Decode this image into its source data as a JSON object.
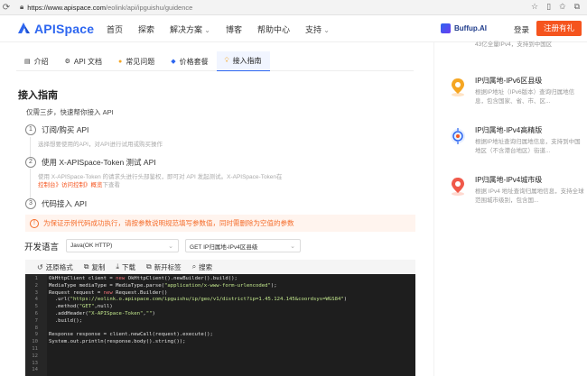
{
  "browser": {
    "url_host": "https://www.apispace.com",
    "url_path": "/eolink/api/ipguishu/guidence"
  },
  "header": {
    "logo_text": "APISpace",
    "nav": [
      {
        "label": "首页",
        "dropdown": false
      },
      {
        "label": "探索",
        "dropdown": false
      },
      {
        "label": "解决方案",
        "dropdown": true
      },
      {
        "label": "博客",
        "dropdown": false
      },
      {
        "label": "帮助中心",
        "dropdown": false
      },
      {
        "label": "支持",
        "dropdown": true
      }
    ],
    "buffup_label": "Buffup.AI",
    "login_label": "登录",
    "register_label": "注册有礼"
  },
  "tabs": [
    {
      "label": "介绍",
      "icon": "doc-icon",
      "active": false
    },
    {
      "label": "API 文档",
      "icon": "api-doc-icon",
      "active": false
    },
    {
      "label": "常见问题",
      "icon": "faq-icon",
      "active": false
    },
    {
      "label": "价格套餐",
      "icon": "diamond-icon",
      "active": false
    },
    {
      "label": "接入指南",
      "icon": "bulb-icon",
      "active": true
    }
  ],
  "guide": {
    "title": "接入指南",
    "subtitle": "仅需三步，快速帮你接入 API",
    "steps": [
      {
        "num": "1",
        "title": "订阅/购买 API",
        "desc": "选择想要使用的API，对API进行试用或购买操作"
      },
      {
        "num": "2",
        "title": "使用 X-APISpace-Token 测试 API",
        "desc_line1": "使用 X-APISpace-Token 的请求头进行头部鉴权，即可对 API 发起测试。X-APISpace-Token在",
        "desc_link": "控制台》访问控制》概览",
        "desc_suffix": "下查看"
      },
      {
        "num": "3",
        "title": "代码接入 API"
      }
    ],
    "warning": "为保证示例代码成功执行，请按参数说明规范填写参数值，同时需删除为空值的参数"
  },
  "dev": {
    "label": "开发语言",
    "language_value": "Java(OK HTTP)",
    "api_value": "GET IP归属地-IPv4区县级"
  },
  "toolbar": {
    "reset": "还原格式",
    "copy": "复制",
    "download": "下载",
    "new_tab": "新开标签",
    "search": "搜索"
  },
  "code_lines": [
    {
      "n": "1",
      "parts": [
        [
          "",
          "OkHttpClient client = "
        ],
        [
          "kw",
          "new"
        ],
        [
          "",
          " OkHttpClient().newBuilder().build();"
        ]
      ]
    },
    {
      "n": "2",
      "parts": [
        [
          "",
          "MediaType mediaType = MediaType.parse("
        ],
        [
          "st",
          "\"application/x-www-form-urlencoded\""
        ],
        [
          "",
          ");"
        ]
      ]
    },
    {
      "n": "3",
      "parts": [
        [
          "",
          "Request request = "
        ],
        [
          "kw",
          "new"
        ],
        [
          "",
          " Request.Builder()"
        ]
      ]
    },
    {
      "n": "4",
      "parts": [
        [
          "",
          "  .url("
        ],
        [
          "st",
          "\"https://eolink.o.apispace.com/ipguishu/ip/geo/v1/district?ip=1.45.124.145&coordsys=WGS84\""
        ],
        [
          "",
          ")"
        ]
      ]
    },
    {
      "n": "5",
      "parts": [
        [
          "",
          "  .method("
        ],
        [
          "st",
          "\"GET\""
        ],
        [
          "",
          ",null)"
        ]
      ]
    },
    {
      "n": "6",
      "parts": [
        [
          "",
          "  .addHeader("
        ],
        [
          "st",
          "\"X-APISpace-Token\""
        ],
        [
          "",
          ","
        ],
        [
          "st",
          "\"\""
        ],
        [
          "",
          ")"
        ]
      ]
    },
    {
      "n": "7",
      "parts": [
        [
          "",
          "  .build();"
        ]
      ]
    },
    {
      "n": "8",
      "parts": []
    },
    {
      "n": "9",
      "parts": [
        [
          "",
          "Response response = client.newCall(request).execute();"
        ]
      ]
    },
    {
      "n": "10",
      "parts": [
        [
          "",
          "System.out.println(response.body().string());"
        ]
      ]
    },
    {
      "n": "11",
      "parts": []
    },
    {
      "n": "12",
      "parts": []
    },
    {
      "n": "13",
      "parts": []
    },
    {
      "n": "14",
      "parts": []
    }
  ],
  "related_apis": [
    {
      "title": "",
      "desc": "43亿全量IPv4，支持到中国区"
    },
    {
      "title": "IP归属地-IPv6区县级",
      "desc": "根据IP地址（IPv6版本）查询归属地信息，包含国家、省、市、区..."
    },
    {
      "title": "IP归属地-IPv4高精版",
      "desc": "根据IP地址查询归属地信息，支持到中国地区（不含港台地区）街道..."
    },
    {
      "title": "IP归属地-IPv4城市级",
      "desc": "根据 IPv4 地址查询归属地信息，支持全球范围城市级别，包含国..."
    }
  ],
  "colors": {
    "brand_blue": "#2d66f0",
    "accent_orange": "#f5541e",
    "warn_orange": "#f56c2a"
  }
}
